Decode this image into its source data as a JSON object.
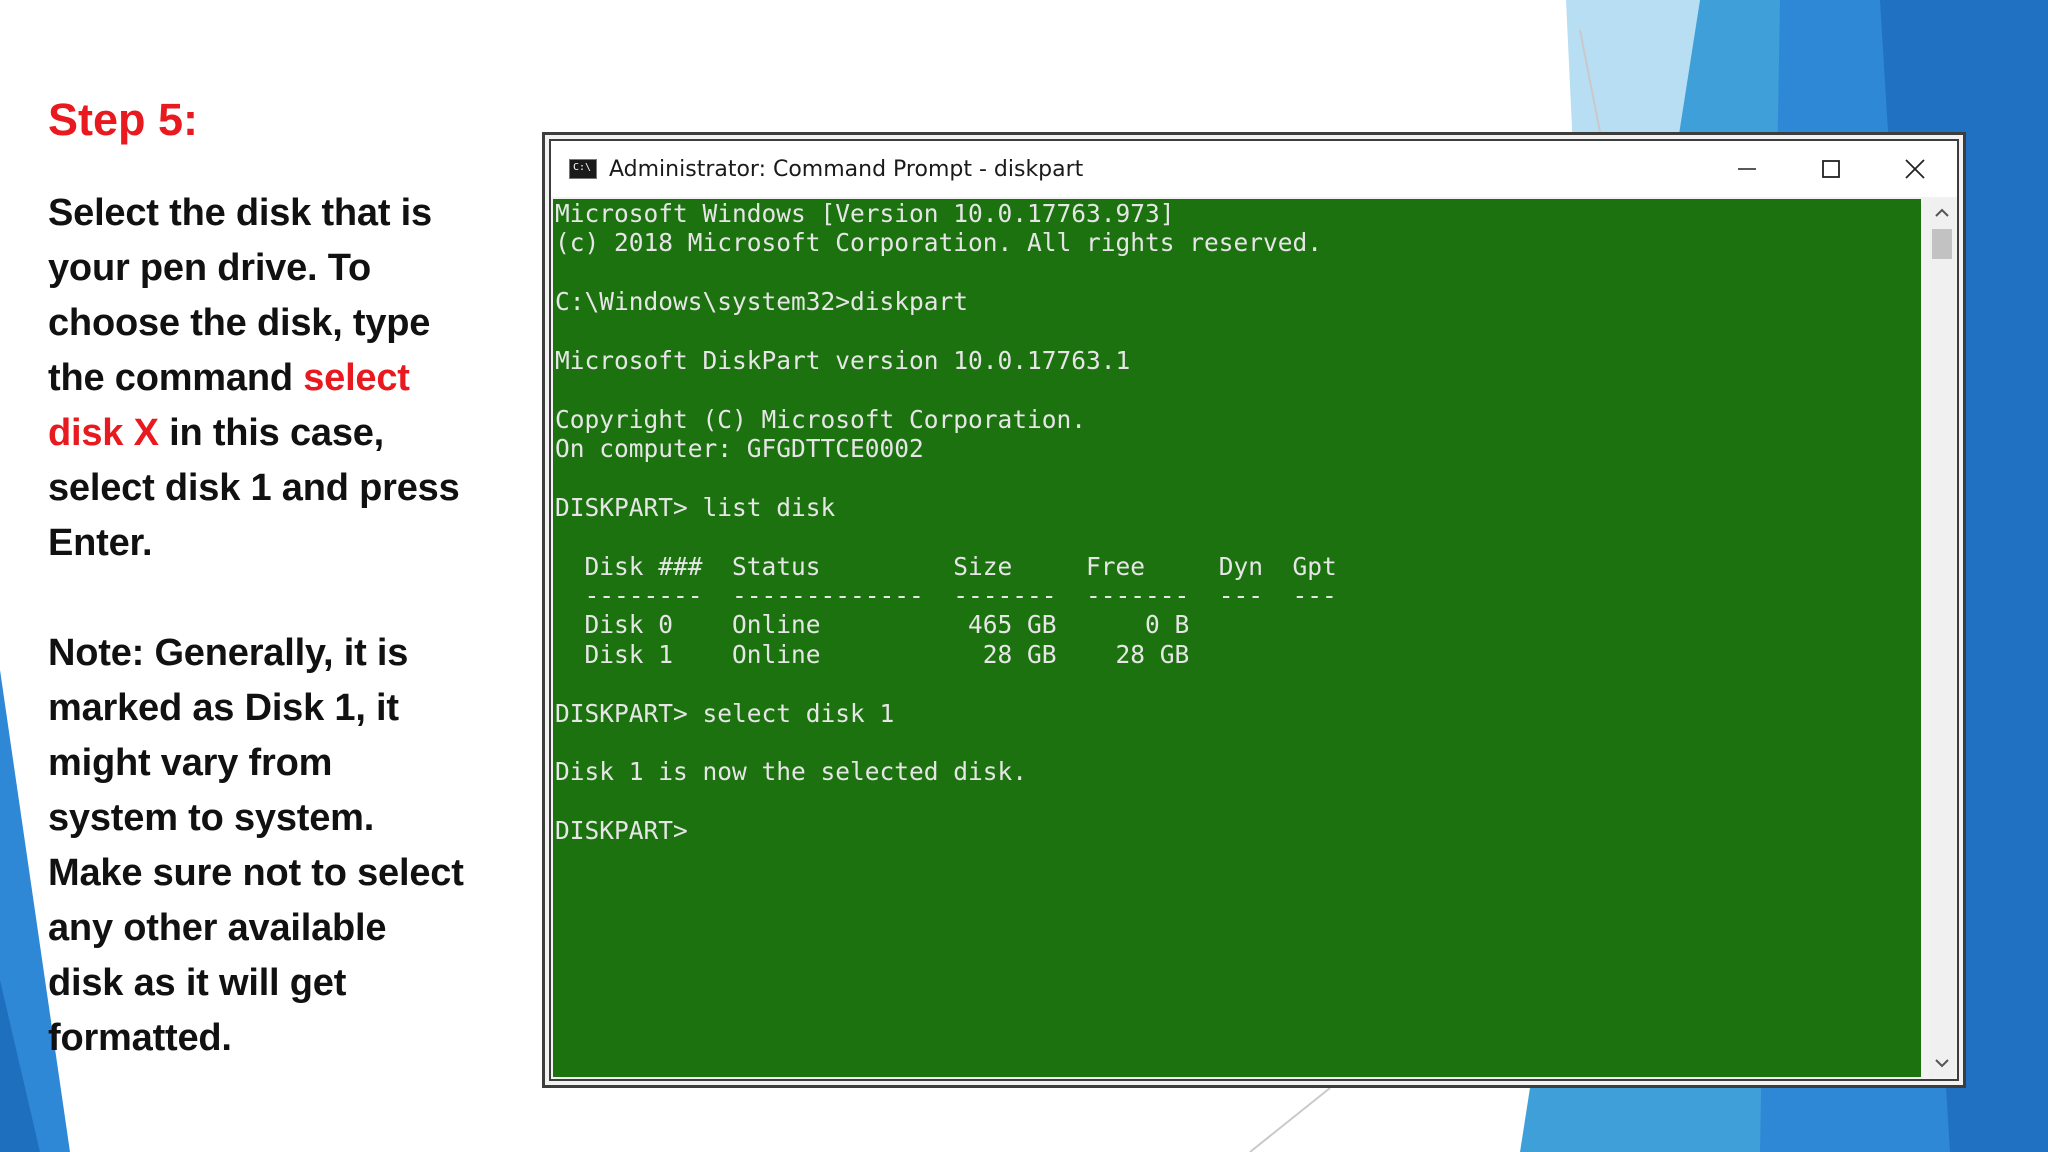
{
  "slide": {
    "step_title": "Step 5:",
    "instruction": {
      "part1": "Select the disk that is your pen drive. To choose the disk, type the command ",
      "command": "select disk X",
      "part2": " in this case, select disk 1 and press Enter."
    },
    "note": "Note: Generally, it is marked as Disk 1, it might vary from system to system. Make sure not to select any other available disk as it will get formatted."
  },
  "window": {
    "title": "Administrator: Command Prompt - diskpart",
    "icon": "cmd-icon",
    "controls": [
      "minimize-icon",
      "maximize-icon",
      "close-icon"
    ]
  },
  "console": {
    "lines": [
      "Microsoft Windows [Version 10.0.17763.973]",
      "(c) 2018 Microsoft Corporation. All rights reserved.",
      "",
      "C:\\Windows\\system32>diskpart",
      "",
      "Microsoft DiskPart version 10.0.17763.1",
      "",
      "Copyright (C) Microsoft Corporation.",
      "On computer: GFGDTTCE0002",
      "",
      "DISKPART> list disk",
      "",
      "  Disk ###  Status         Size     Free     Dyn  Gpt",
      "  --------  -------------  -------  -------  ---  ---",
      "  Disk 0    Online          465 GB      0 B",
      "  Disk 1    Online           28 GB    28 GB",
      "",
      "DISKPART> select disk 1",
      "",
      "Disk 1 is now the selected disk.",
      "",
      "DISKPART> "
    ]
  },
  "theme": {
    "accent_red": "#e8191f",
    "console_bg": "#1c720f",
    "console_fg": "#e6e6e6",
    "deco_blue": "#2f88d6"
  }
}
